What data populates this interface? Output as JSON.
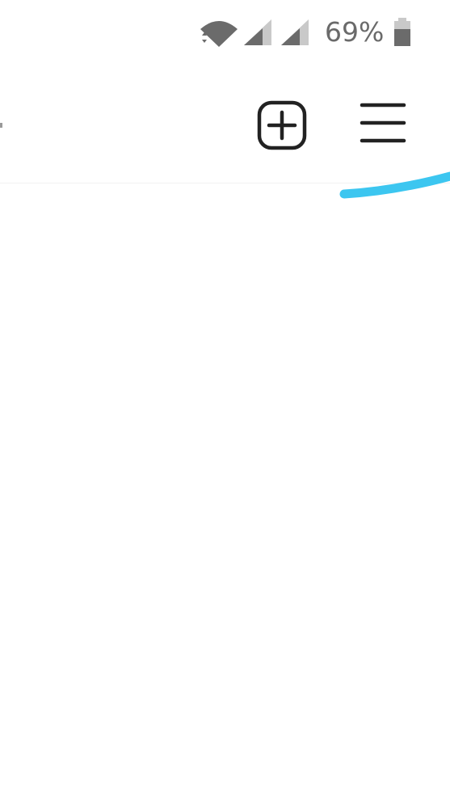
{
  "status_bar": {
    "battery_percent": "69%",
    "icons": [
      "wifi-icon",
      "signal-icon",
      "signal-icon",
      "battery-icon"
    ]
  },
  "toolbar": {
    "icons": [
      "new-post-icon",
      "menu-icon"
    ]
  },
  "annotation": {
    "color": "#3cc6f0"
  },
  "colors": {
    "icon": "#222222",
    "status_icon": "#6b6b6b",
    "status_icon_light": "#c9c9c9",
    "background": "#ffffff"
  }
}
